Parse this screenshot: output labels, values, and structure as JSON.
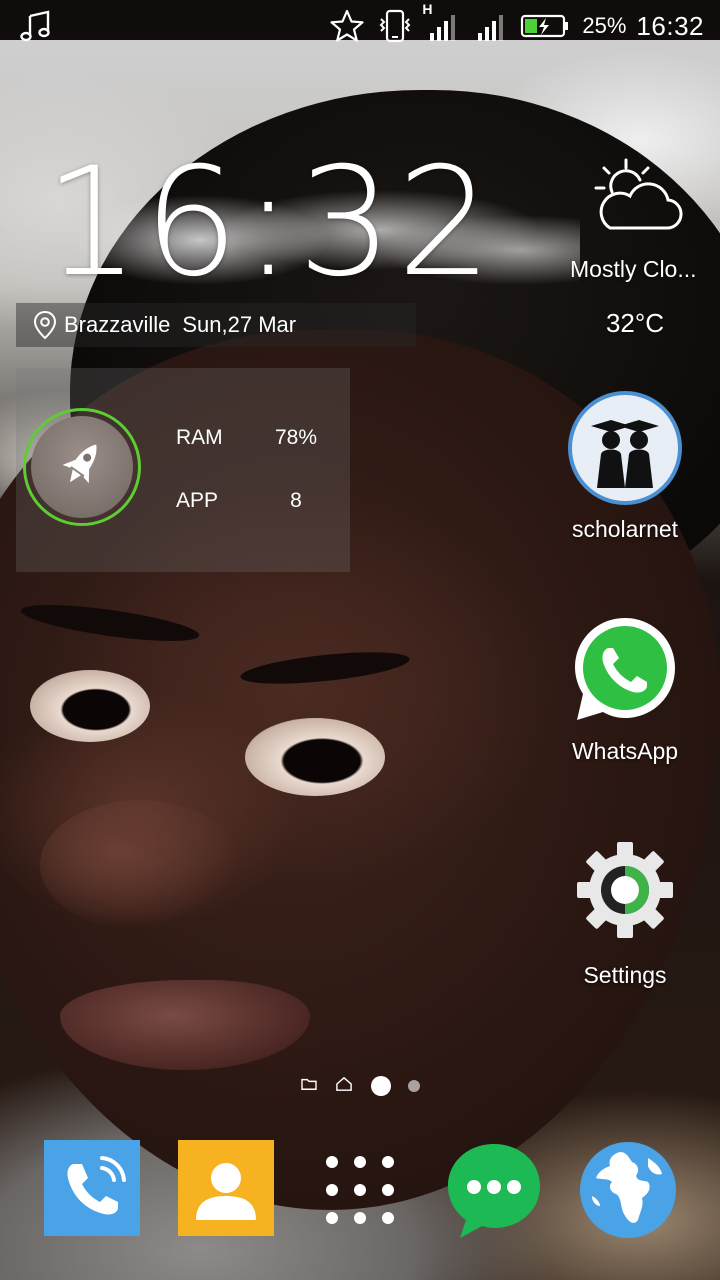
{
  "status_bar": {
    "battery_percent": "25%",
    "time": "16:32",
    "network_type": "H",
    "icons": [
      "music-note-icon",
      "star-icon",
      "phone-vibrate-icon",
      "signal-icon",
      "signal-icon",
      "battery-charging-icon"
    ]
  },
  "clock_widget": {
    "time": "16:32",
    "location": "Brazzaville",
    "date": "Sun,27 Mar"
  },
  "weather_widget": {
    "condition": "Mostly Clo...",
    "temperature": "32°C",
    "icon": "partly-cloudy-icon"
  },
  "booster_widget": {
    "ram_label": "RAM",
    "ram_value": "78%",
    "app_label": "APP",
    "app_value": "8",
    "ring_color": "#5fcc33",
    "icon": "rocket-icon"
  },
  "apps": [
    {
      "label": "scholarnet",
      "icon": "scholarnet-icon"
    },
    {
      "label": "WhatsApp",
      "icon": "whatsapp-icon",
      "color": "#2fc043"
    },
    {
      "label": "Settings",
      "icon": "settings-icon",
      "accent": "#3db34a"
    }
  ],
  "page_indicator": {
    "items": [
      "folder-icon",
      "home-icon",
      "dot-active",
      "dot"
    ],
    "active_index": 2
  },
  "dock": [
    {
      "icon": "phone-dialer-icon",
      "color": "#4aa3e6"
    },
    {
      "icon": "contacts-icon",
      "color": "#f6b221"
    },
    {
      "icon": "app-drawer-icon"
    },
    {
      "icon": "messages-icon",
      "color": "#1db954"
    },
    {
      "icon": "browser-globe-icon",
      "color": "#4aa3e6"
    }
  ]
}
